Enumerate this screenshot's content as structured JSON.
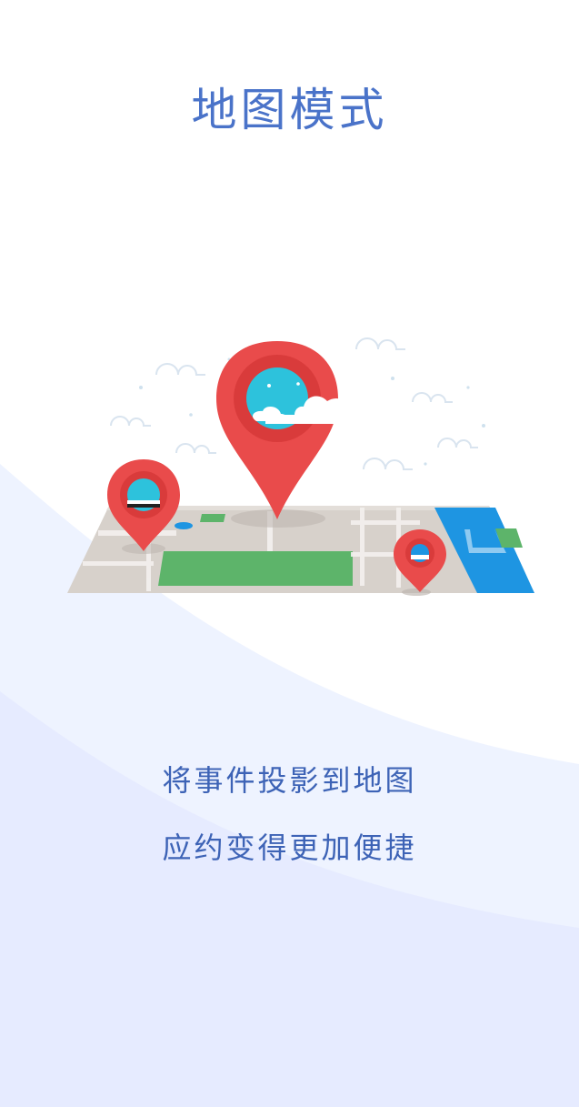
{
  "title": "地图模式",
  "subtitle_lines": [
    "将事件投影到地图",
    "应约变得更加便捷"
  ],
  "illustration": {
    "icons": [
      "map-icon",
      "location-pin-icon",
      "cloud-icon"
    ]
  },
  "colors": {
    "title": "#4a73c9",
    "text": "#3d63b6",
    "pin": "#e94b4b",
    "pin_inner": "#d93b3b",
    "sky": "#2dc2dc",
    "water": "#1e95e2",
    "park": "#5db46a",
    "map": "#d7d1cb",
    "wave_light": "#eef3ff",
    "wave": "#e6ebff"
  }
}
